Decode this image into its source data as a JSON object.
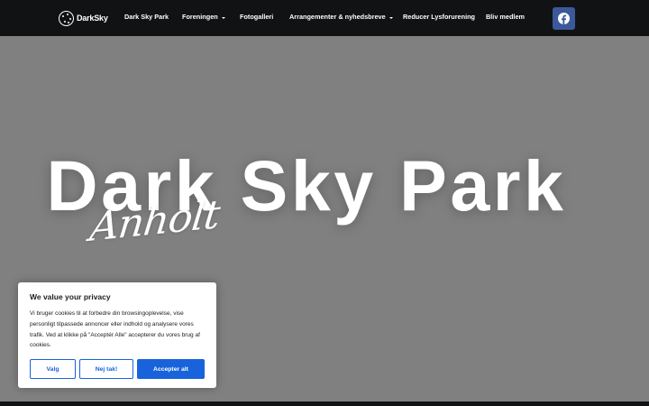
{
  "brand": {
    "name": "DarkSky"
  },
  "nav": {
    "items": [
      {
        "label": "Dark Sky Park",
        "dropdown": false
      },
      {
        "label": "Foreningen",
        "dropdown": true
      },
      {
        "label": "Fotogalleri",
        "dropdown": false
      },
      {
        "label": "Arrangementer & nyhedsbreve",
        "dropdown": true
      },
      {
        "label": "Reducer Lysforurening",
        "dropdown": false
      },
      {
        "label": "Bliv medlem",
        "dropdown": false
      }
    ],
    "social_icon": "facebook-icon"
  },
  "hero": {
    "title": "Dark Sky Park",
    "subtitle": "Anholt"
  },
  "cookie_banner": {
    "title": "We value your privacy",
    "text": "Vi bruger cookies til at forbedre din browsingoplevelse, vise personligt tilpassede annoncer eller indhold og analysere vores trafik. Ved at klikke på \"Acceptér Alle\" accepterer du vores brug af cookies.",
    "customize_label": "Valg",
    "reject_label": "Nej tak!",
    "accept_label": "Accepter alt"
  },
  "colors": {
    "navbar": "#111214",
    "hero_background": "#808080",
    "facebook": "#3b5998",
    "accent": "#1863dc"
  }
}
